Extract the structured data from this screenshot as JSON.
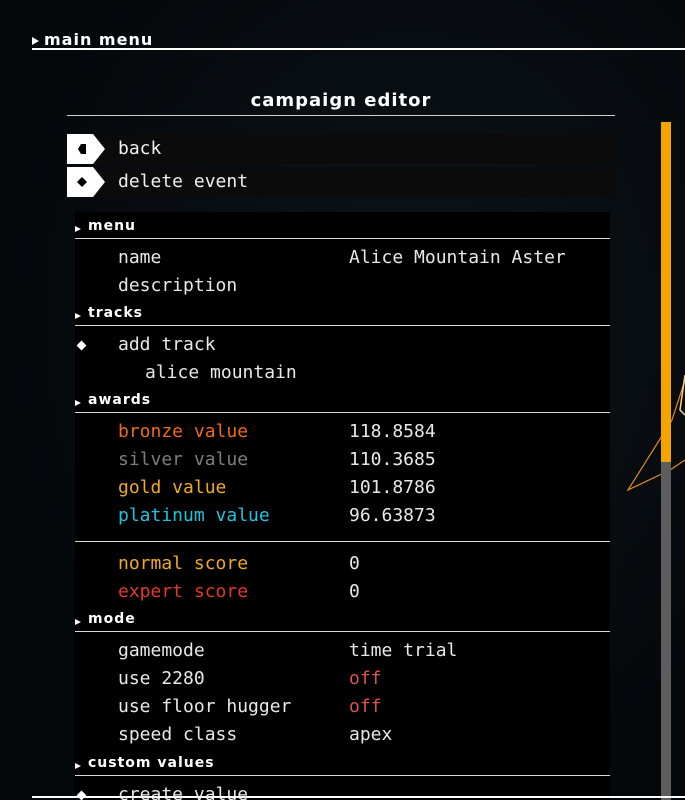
{
  "header": {
    "title": "main menu"
  },
  "panel": {
    "title": "campaign editor",
    "back_label": "back",
    "delete_label": "delete event"
  },
  "sections": {
    "menu": {
      "title": "menu",
      "name_key": "name",
      "name_value": "Alice Mountain Aster",
      "description_key": "description"
    },
    "tracks": {
      "title": "tracks",
      "add_track": "add track",
      "track_item": "alice mountain"
    },
    "awards": {
      "title": "awards",
      "bronze_key": "bronze value",
      "bronze_value": "118.8584",
      "silver_key": "silver value",
      "silver_value": "110.3685",
      "gold_key": "gold value",
      "gold_value": "101.8786",
      "platinum_key": "platinum value",
      "platinum_value": "96.63873",
      "normal_key": "normal score",
      "normal_value": "0",
      "expert_key": "expert score",
      "expert_value": "0"
    },
    "mode": {
      "title": "mode",
      "gamemode_key": "gamemode",
      "gamemode_value": "time trial",
      "use2280_key": "use 2280",
      "use2280_value": "off",
      "floor_key": "use floor hugger",
      "floor_value": "off",
      "speed_key": "speed class",
      "speed_value": "apex"
    },
    "custom": {
      "title": "custom values",
      "create_value": "create value"
    }
  },
  "colors": {
    "bronze": "#f06a16",
    "silver": "#7d7d7d",
    "gold": "#f2a823",
    "platinum": "#1ec4de",
    "normal": "#f2a823",
    "expert": "#e23a2a",
    "off": "#d9534f",
    "scroll_thumb": "#f3a400"
  },
  "icons": {
    "back": "back-arrow-icon",
    "delete": "diamond-icon"
  },
  "scroll": {
    "thumb_fraction": 0.5
  }
}
